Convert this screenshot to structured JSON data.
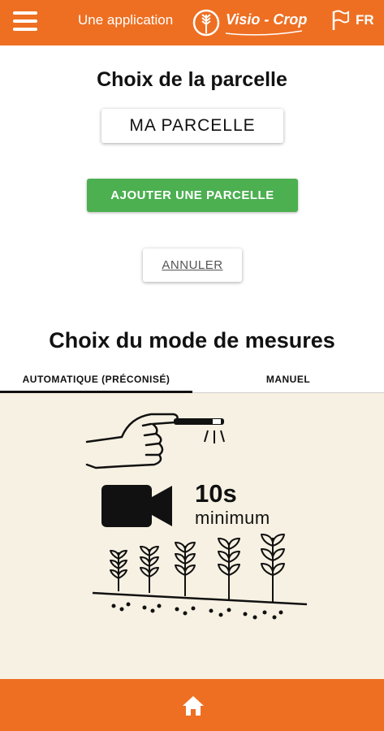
{
  "header": {
    "app_intro": "Une application",
    "brand": "Visio - Crop",
    "lang": "FR"
  },
  "parcel": {
    "title": "Choix de la parcelle",
    "selected": "MA PARCELLE",
    "add_label": "AJOUTER UNE PARCELLE",
    "cancel_label": "ANNULER"
  },
  "measure": {
    "title": "Choix du mode de mesures",
    "tabs": [
      {
        "label": "AUTOMATIQUE (PRÉCONISÉ)",
        "active": true
      },
      {
        "label": "MANUEL",
        "active": false
      }
    ],
    "duration": "10s",
    "duration_note": "minimum"
  },
  "colors": {
    "accent": "#ee6f22",
    "add_button": "#4caf50",
    "illustration_bg": "#f7f1e3"
  },
  "icons": {
    "menu": "hamburger-menu-icon",
    "flag": "flag-icon",
    "home": "home-icon",
    "camera": "video-camera-icon"
  }
}
